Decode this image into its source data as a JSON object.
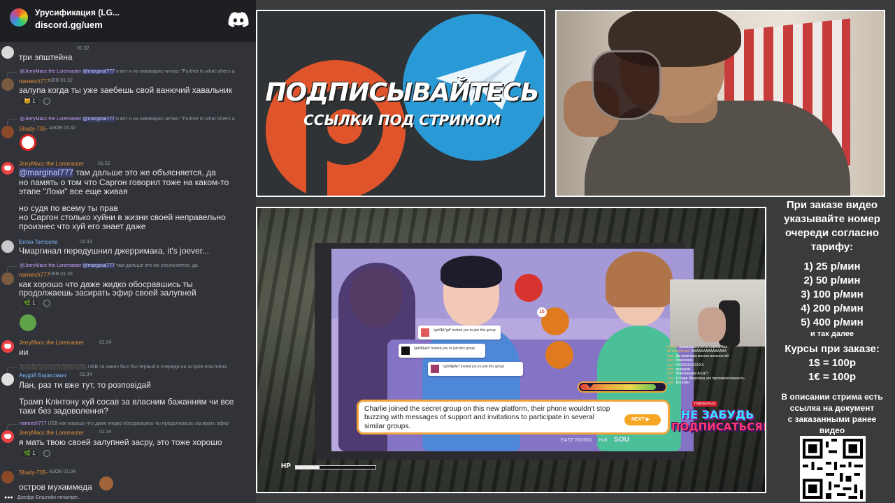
{
  "discord": {
    "server_name": "Урусификация (LG...",
    "invite_link": "discord.gg/uem",
    "typing_text": "Джефрі Епштейн печатает...",
    "messages": [
      {
        "user": "",
        "time": "01:32",
        "text": "три эпштейна"
      },
      {
        "reply_user": "@JerryMacc the Loremaster",
        "reply_mention": "@marginal777",
        "reply_text": "и вот я на кививарис читаю: \"Further to what others a",
        "user": "naneech777",
        "badge": "UEB",
        "time": "01:32",
        "text": "залупа когда ты уже заебешь свой ванючий хавальник",
        "reaction_count": "1"
      },
      {
        "reply_user": "@JerryMacc the Loremaster",
        "reply_mention": "@marginal777",
        "reply_text": "и вот я на кививарис читаю: \"Further to what others a",
        "user": "Shady-705-",
        "badge": "АЗОВ",
        "time": "01:32"
      },
      {
        "user": "JerryMacc the Loremaster",
        "time": "01:32",
        "mention": "@marginal777",
        "lines": [
          "там дальше это же объясняется, да",
          "но память о том что Саргон говорил тоже на каком-то",
          "этапе \"Локи\" все еще живая",
          "но судя по всему ты прав",
          "но Саргон столько хуйни в жизни своей неправельно",
          "произнес что хуй его знает даже"
        ]
      },
      {
        "user": "Ennio Terricone",
        "time": "01:33",
        "text": "Чмаргинал передушнил джерримака, it's joever..."
      },
      {
        "reply_user": "@JerryMacc the Loremaster",
        "reply_mention": "@marginal777",
        "reply_text": "там дальше это же объясняется, да",
        "user": "naneech777",
        "badge": "UEB",
        "time": "01:33",
        "lines": [
          "как хорошо что даже жидко обосравшись ты",
          "продолжаешь засирать эфир своей залупней"
        ],
        "reaction_count": "1"
      },
      {
        "user": "JerryMacc the Loremaster",
        "time": "01:34",
        "text": "ии"
      },
      {
        "reply_text": "та ханич был бы первый в очереди на остров епштейна",
        "reply_badge": "UEB",
        "user": "Андрій Борисович",
        "time": "01:34",
        "lines": [
          "Лан, раз ти вже тут, то розповідай",
          "Трамп Клінтону хуй сосав за власним бажанням чи все",
          "таки без задоволення?"
        ]
      },
      {
        "reply_user": "naneech777",
        "reply_badge": "UEB",
        "reply_text": "как хорошо что даже жидко обосравшись ты продолжаешь засирать эфир",
        "user": "JerryMacc the Loremaster",
        "time": "01:34",
        "text": "я мать твою своей залупней засру, это тоже хорошо",
        "reaction_count": "1"
      },
      {
        "user": "Shady-705-",
        "badge": "АЗОВ",
        "time": "01:34",
        "text": "остров мухаммеда"
      }
    ]
  },
  "promo": {
    "title": "ПОДПИСЫВАЙТЕСЬ",
    "subtitle": "ССЫЛКИ ПОД СТРИМОМ"
  },
  "game": {
    "notifications": [
      "!gd#$&*gd* invited you to join this group",
      "!gd#$&As* invited you to join this group",
      "!gd#$&As* invited you to join this group"
    ],
    "notif_badge": "16",
    "dialog_text": "Charlie joined the secret group on this new platform, their phone wouldn't stop buzzing with messages of support and invitations to participate in several similar groups.",
    "next_label": "NEXT",
    "logo_1": "EAST RIDING",
    "logo_2": "Hull",
    "logo_3": "SOU",
    "hp_label": "HP",
    "hp_fraction": 0.3,
    "meter_fraction": 0.9,
    "sticker_tag": "Подписаться",
    "sticker_line1": "НЕ ЗАБУДЬ",
    "sticker_line2": "ПОДПИСАТЬСЯ!",
    "overlay_chat": [
      {
        "name": "Instrixi:",
        "text": "ахахахаха он ксть слилки бол"
      },
      {
        "name": "MrYanochman:",
        "text": "ААААААААААААААА"
      },
      {
        "name": "user:",
        "text": "Да отмечаем жестко вольностей"
      },
      {
        "name": "user:",
        "text": "Ахахахаха"
      },
      {
        "name": "user:",
        "text": "XXXXXXXXXXXX"
      },
      {
        "name": "user:",
        "text": "ахахахах"
      },
      {
        "name": "user:",
        "text": "Приложение Асса!?"
      },
      {
        "name": "user:",
        "text": "Остров Эпштейна это противоположность"
      },
      {
        "name": "user:",
        "text": "Ёптабин"
      }
    ]
  },
  "info": {
    "heading_lines": [
      "При заказе видео",
      "указывайте номер",
      "очереди согласно",
      "тарифу:"
    ],
    "tariffs": [
      "1) 25 р/мин",
      "2) 50 р/мин",
      "3) 100 р/мин",
      "4) 200 р/мин",
      "5) 400 р/мин"
    ],
    "further": "и так далее",
    "courses_lines": [
      "Курсы при заказе:",
      "1$ = 100р",
      "1€ = 100р"
    ],
    "desc_lines": [
      "В описании стрима есть",
      "ссылка на документ",
      "с заказанными ранее",
      "видео"
    ]
  },
  "colors": {
    "discord_bg": "#313338",
    "telegram_blue": "#2a9ad6",
    "patreon_orange": "#e0542c",
    "dialog_border": "#f2a33c"
  }
}
